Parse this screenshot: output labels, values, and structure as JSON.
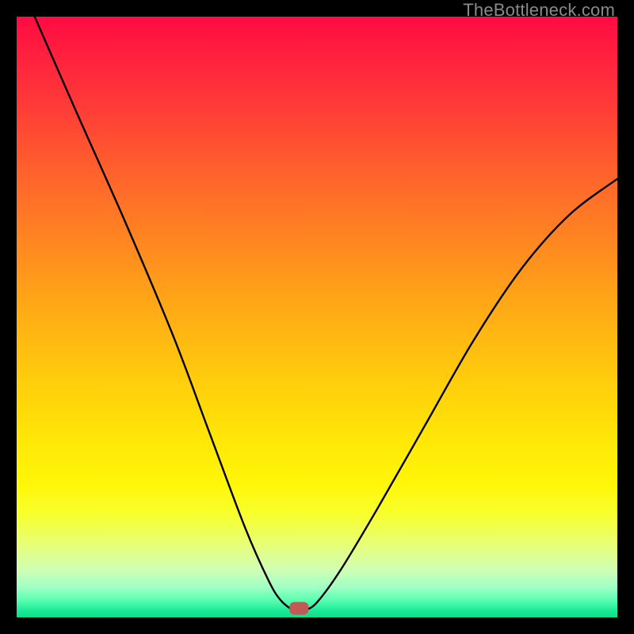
{
  "watermark": "TheBottleneck.com",
  "chart_data": {
    "type": "line",
    "title": "",
    "xlabel": "",
    "ylabel": "",
    "xlim": [
      0,
      100
    ],
    "ylim": [
      0,
      100
    ],
    "series": [
      {
        "name": "bottleneck-curve",
        "x": [
          3,
          10,
          18,
          26,
          32,
          38,
          42,
          44,
          46,
          47,
          48,
          50,
          54,
          60,
          68,
          76,
          84,
          92,
          100
        ],
        "values": [
          100,
          84,
          66,
          47,
          31,
          15,
          6,
          2.8,
          1.2,
          1,
          1.2,
          2.5,
          8,
          18,
          32,
          46,
          58,
          67,
          73
        ]
      }
    ],
    "marker": {
      "x": 47,
      "y": 1.5,
      "color": "#c05a54"
    },
    "grid": false,
    "legend": false
  }
}
